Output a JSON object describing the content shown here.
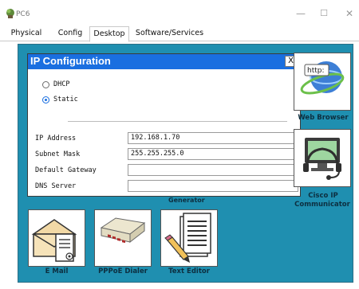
{
  "window": {
    "title": "PC6",
    "minimize_glyph": "—",
    "maximize_glyph": "☐",
    "close_glyph": "✕"
  },
  "tabs": [
    {
      "label": "Physical",
      "active": false
    },
    {
      "label": "Config",
      "active": false
    },
    {
      "label": "Desktop",
      "active": true
    },
    {
      "label": "Software/Services",
      "active": false
    }
  ],
  "dialog": {
    "title": "IP Configuration",
    "close_glyph": "X",
    "options": [
      {
        "label": "DHCP",
        "selected": false
      },
      {
        "label": "Static",
        "selected": true
      }
    ],
    "fields": [
      {
        "label": "IP Address",
        "value": "192.168.1.70"
      },
      {
        "label": "Subnet Mask",
        "value": "255.255.255.0"
      },
      {
        "label": "Default Gateway",
        "value": ""
      },
      {
        "label": "DNS Server",
        "value": ""
      }
    ]
  },
  "desktop_apps": {
    "web_browser": {
      "label": "Web Browser",
      "icon": "web-browser-icon",
      "url_text": "http:"
    },
    "cisco_ip_communicator": {
      "label_line1": "Cisco IP",
      "label_line2": "Communicator",
      "icon": "headset-monitor-icon"
    },
    "hidden_label": "Generator",
    "email": {
      "label": "E Mail",
      "icon": "email-icon"
    },
    "pppoe_dialer": {
      "label": "PPPoE Dialer",
      "icon": "modem-icon"
    },
    "text_editor": {
      "label": "Text Editor",
      "icon": "text-editor-icon"
    }
  },
  "colors": {
    "desktop": "#1f8fb0",
    "dialog_title": "#1a6fe0",
    "radio_selected": "#1a6fe0"
  }
}
